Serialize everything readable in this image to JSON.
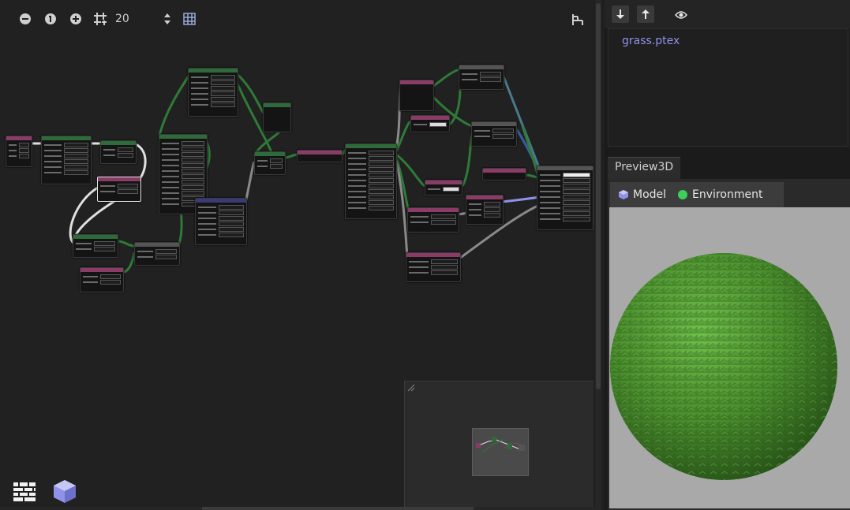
{
  "app": {
    "grid_size": "20"
  },
  "toolbar": {
    "zoom_out_icon": "zoom-out-icon",
    "zoom_reset_icon": "zoom-reset-icon",
    "zoom_in_icon": "zoom-in-icon",
    "grid_icon": "grid-icon",
    "frame_icon": "frame-icon"
  },
  "files": {
    "items": [
      "grass.ptex"
    ]
  },
  "preview": {
    "tab_label": "Preview3D",
    "menu": [
      {
        "label": "Model",
        "icon": "cube-icon"
      },
      {
        "label": "Environment",
        "icon": "green-dot-icon"
      }
    ]
  },
  "colors": {
    "accent": "#8f92e8",
    "node_green": "#2e6b3a",
    "node_pink": "#8a3c66",
    "node_gray": "#555555",
    "node_blue": "#3a3a7a",
    "sphere": "#4b8f2e",
    "viewport": "#a9a9a9"
  }
}
